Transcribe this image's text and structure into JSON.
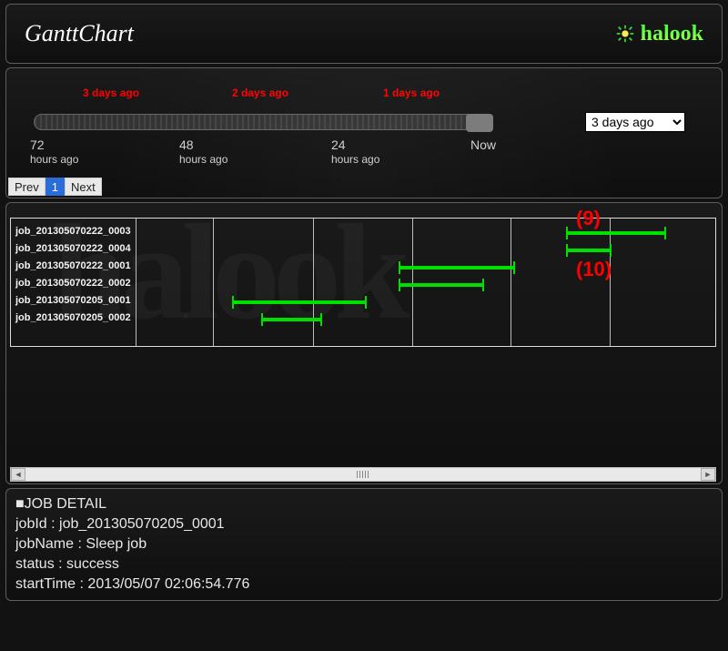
{
  "header": {
    "title": "GanttChart",
    "brand": "halook"
  },
  "range": {
    "red_labels": [
      "3 days ago",
      "2 days ago",
      "1 days ago"
    ],
    "ticks": [
      {
        "big": "72",
        "small": "hours ago"
      },
      {
        "big": "48",
        "small": "hours ago"
      },
      {
        "big": "24",
        "small": "hours ago"
      },
      {
        "big": "Now",
        "small": ""
      }
    ],
    "dropdown_value": "3 days ago"
  },
  "pager": {
    "prev": "Prev",
    "page": "1",
    "next": "Next"
  },
  "jobs": [
    "job_201305070222_0003",
    "job_201305070222_0004",
    "job_201305070222_0001",
    "job_201305070222_0002",
    "job_201305070205_0001",
    "job_201305070205_0002"
  ],
  "annotations": {
    "a9": "(9)",
    "a10": "(10)"
  },
  "chart_data": {
    "type": "bar",
    "title": "GanttChart",
    "xlabel": "hours ago",
    "x_range_hours": [
      72,
      0
    ],
    "series": [
      {
        "name": "job_201305070222_0003",
        "start_h_ago": 13,
        "end_h_ago": 3
      },
      {
        "name": "job_201305070222_0004",
        "start_h_ago": 13,
        "end_h_ago": 8
      },
      {
        "name": "job_201305070222_0001",
        "start_h_ago": 30,
        "end_h_ago": 18
      },
      {
        "name": "job_201305070222_0002",
        "start_h_ago": 30,
        "end_h_ago": 21
      },
      {
        "name": "job_201305070205_0001",
        "start_h_ago": 47,
        "end_h_ago": 33
      },
      {
        "name": "job_201305070205_0002",
        "start_h_ago": 44,
        "end_h_ago": 38
      }
    ]
  },
  "detail": {
    "heading": "■JOB DETAIL",
    "l1": "jobId : job_201305070205_0001",
    "l2": "jobName : Sleep job",
    "l3": "status : success",
    "l4": "startTime : 2013/05/07 02:06:54.776"
  }
}
